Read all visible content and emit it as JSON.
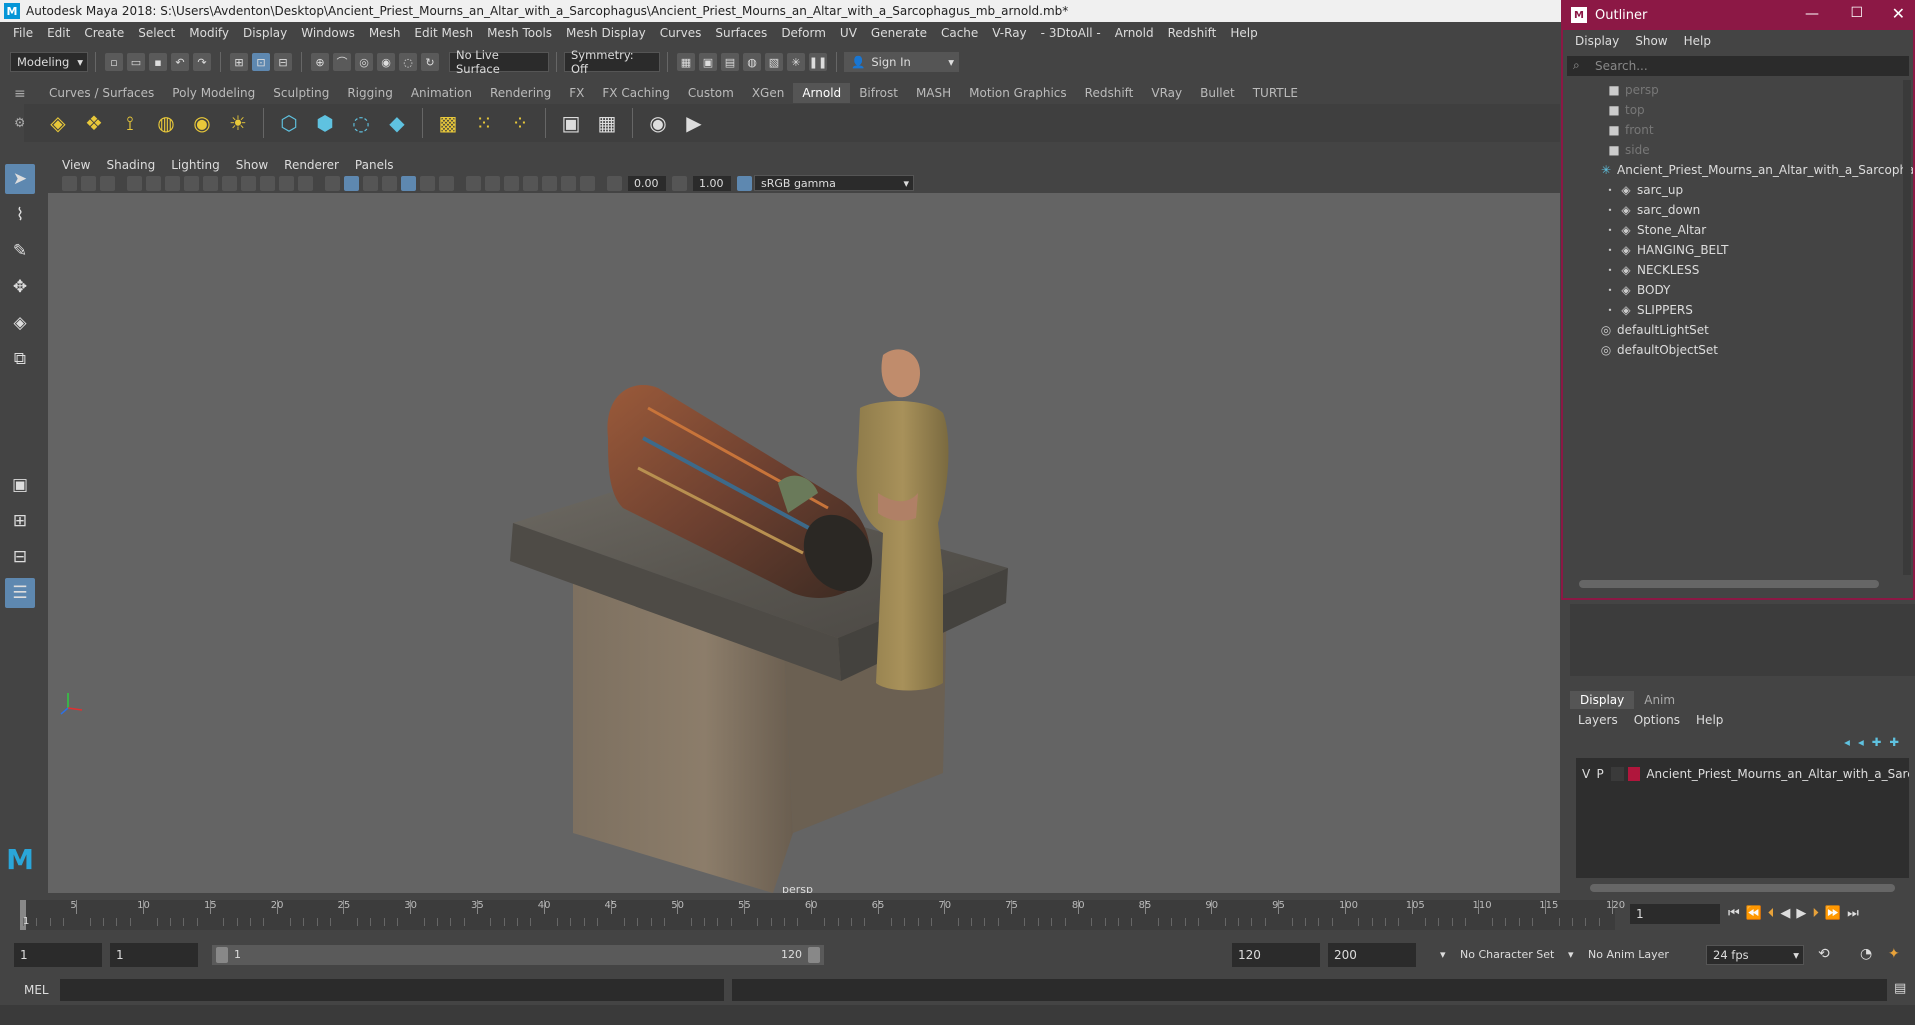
{
  "window": {
    "title": "Autodesk Maya 2018: S:\\Users\\Avdenton\\Desktop\\Ancient_Priest_Mourns_an_Altar_with_a_Sarcophagus\\Ancient_Priest_Mourns_an_Altar_with_a_Sarcophagus_mb_arnold.mb*",
    "logo": "M"
  },
  "menus": [
    "File",
    "Edit",
    "Create",
    "Select",
    "Modify",
    "Display",
    "Windows",
    "Mesh",
    "Edit Mesh",
    "Mesh Tools",
    "Mesh Display",
    "Curves",
    "Surfaces",
    "Deform",
    "UV",
    "Generate",
    "Cache",
    "V-Ray",
    "- 3DtoAll -",
    "Arnold",
    "Redshift",
    "Help"
  ],
  "status": {
    "mode": "Modeling",
    "live_surface": "No Live Surface",
    "symmetry": "Symmetry: Off",
    "sign_in": "Sign In"
  },
  "shelf_tabs": [
    "Curves / Surfaces",
    "Poly Modeling",
    "Sculpting",
    "Rigging",
    "Animation",
    "Rendering",
    "FX",
    "FX Caching",
    "Custom",
    "XGen",
    "Arnold",
    "Bifrost",
    "MASH",
    "Motion Graphics",
    "Redshift",
    "VRay",
    "Bullet",
    "TURTLE"
  ],
  "shelf_active": "Arnold",
  "panel_menu": [
    "View",
    "Shading",
    "Lighting",
    "Show",
    "Renderer",
    "Panels"
  ],
  "panel_tools": {
    "exposure": "0.00",
    "gamma": "1.00",
    "color_space": "sRGB gamma"
  },
  "viewport": {
    "camera_label": "persp"
  },
  "outliner": {
    "title": "Outliner",
    "menu": [
      "Display",
      "Show",
      "Help"
    ],
    "search_placeholder": "Search...",
    "cameras": [
      "persp",
      "top",
      "front",
      "side"
    ],
    "group": "Ancient_Priest_Mourns_an_Altar_with_a_Sarcophagus_r",
    "children": [
      "sarc_up",
      "sarc_down",
      "Stone_Altar",
      "HANGING_BELT",
      "NECKLESS",
      "BODY",
      "SLIPPERS"
    ],
    "sets": [
      "defaultLightSet",
      "defaultObjectSet"
    ]
  },
  "layers": {
    "tabs": [
      "Display",
      "Anim"
    ],
    "menu": [
      "Layers",
      "Options",
      "Help"
    ],
    "layer": {
      "v": "V",
      "p": "P",
      "name": "Ancient_Priest_Mourns_an_Altar_with_a_Sarcoph",
      "color": "#b0163c"
    }
  },
  "timeline": {
    "ticks": [
      "5",
      "10",
      "15",
      "20",
      "25",
      "30",
      "35",
      "40",
      "45",
      "50",
      "55",
      "60",
      "65",
      "70",
      "75",
      "80",
      "85",
      "90",
      "95",
      "100",
      "105",
      "110",
      "115",
      "120"
    ],
    "current_marker": "1",
    "current_frame": "1"
  },
  "range": {
    "start": "1",
    "start2": "1",
    "slider_start": "1",
    "slider_end": "120",
    "end": "120",
    "max": "200",
    "character_set": "No Character Set",
    "anim_layer": "No Anim Layer",
    "fps": "24 fps"
  },
  "cmd": {
    "label": "MEL"
  }
}
